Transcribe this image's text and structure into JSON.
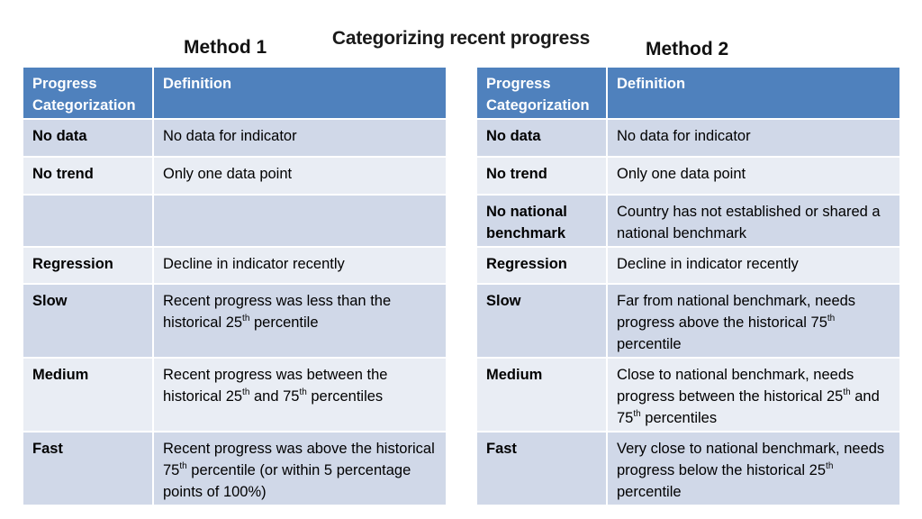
{
  "title": "Categorizing recent progress",
  "colors": {
    "header_bg": "#4F81BD",
    "header_text": "#FFFFFF",
    "row_dark": "#D0D8E8",
    "row_light": "#E9EDF4"
  },
  "method1": {
    "label": "Method 1",
    "headers": {
      "category": "Progress Categorization",
      "definition": "Definition"
    },
    "rows": [
      {
        "category": "No data",
        "definition": [
          "No data for indicator"
        ]
      },
      {
        "category": "No  trend",
        "definition": [
          "Only one data point"
        ]
      },
      {
        "category": "",
        "definition": [
          ""
        ]
      },
      {
        "category": "Regression",
        "definition": [
          "Decline in indicator recently"
        ]
      },
      {
        "category": "Slow",
        "definition": [
          "Recent progress was less than the historical 25",
          "th",
          " percentile"
        ]
      },
      {
        "category": "Medium",
        "definition": [
          "Recent progress was between the historical  25",
          "th",
          " and 75",
          "th",
          " percentiles"
        ]
      },
      {
        "category": "Fast",
        "definition": [
          "Recent progress was above the historical 75",
          "th",
          " percentile (or within 5 percentage points of 100%)"
        ]
      }
    ]
  },
  "method2": {
    "label": "Method 2",
    "headers": {
      "category": "Progress Categorization",
      "definition": "Definition"
    },
    "rows": [
      {
        "category": "No data",
        "definition": [
          "No data for indicator"
        ]
      },
      {
        "category": "No  trend",
        "definition": [
          "Only one data point"
        ]
      },
      {
        "category": "No national benchmark",
        "definition": [
          "Country has not established or shared a national benchmark"
        ]
      },
      {
        "category": "Regression",
        "definition": [
          "Decline in indicator recently"
        ]
      },
      {
        "category": "Slow",
        "definition": [
          "Far from national benchmark, needs progress above the historical 75",
          "th",
          " percentile"
        ]
      },
      {
        "category": "Medium",
        "definition": [
          "Close to national benchmark, needs progress between the historical 25",
          "th",
          " and 75",
          "th",
          " percentiles"
        ]
      },
      {
        "category": "Fast",
        "definition": [
          "Very close to national benchmark, needs progress below the historical 25",
          "th",
          " percentile"
        ]
      }
    ]
  }
}
